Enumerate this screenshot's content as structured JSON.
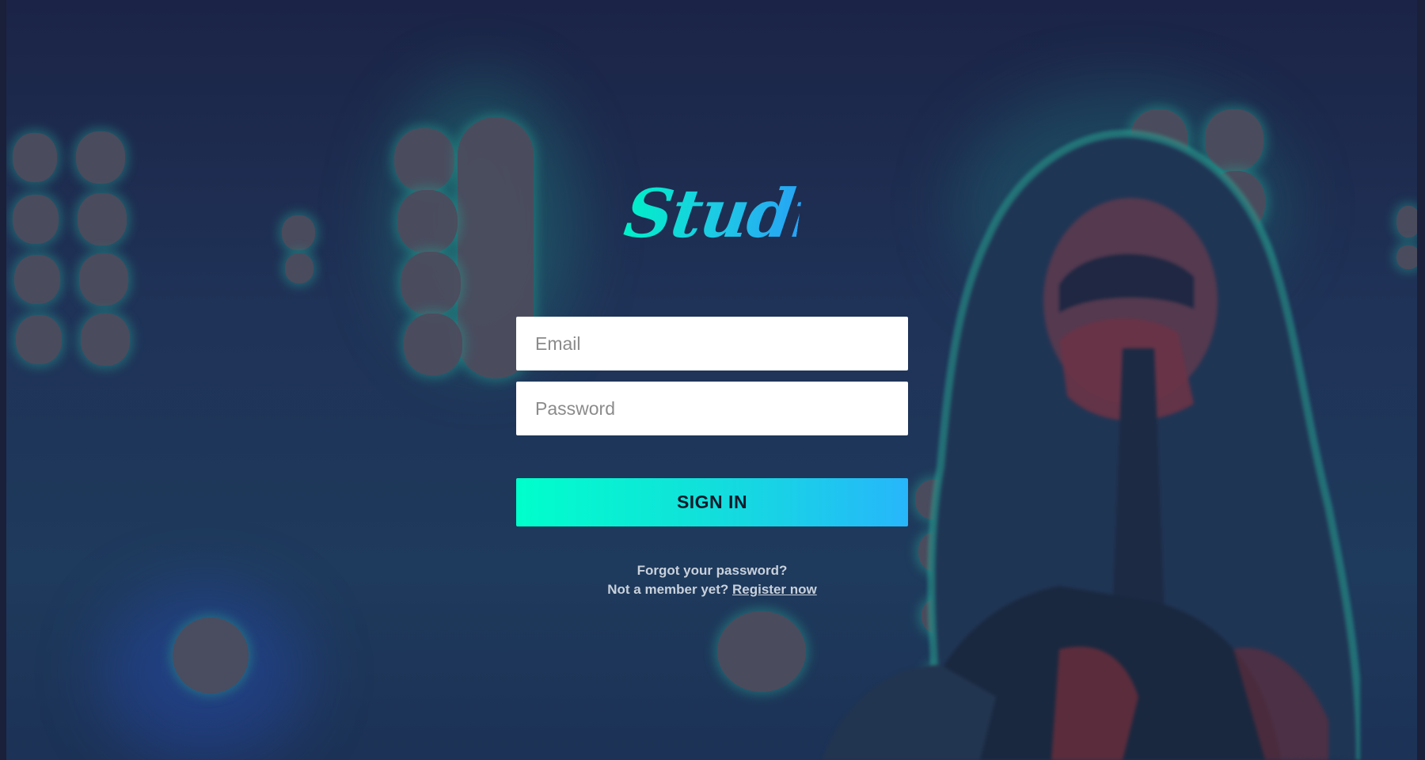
{
  "app": {
    "logo_text": "Studio"
  },
  "form": {
    "email_placeholder": "Email",
    "email_value": "",
    "password_placeholder": "Password",
    "password_value": "",
    "signin_label": "SIGN IN"
  },
  "footer_links": {
    "forgot_password": "Forgot your password?",
    "not_member": "Not a member yet?",
    "register": "Register now"
  },
  "colors": {
    "brand_gradient_start": "#00ffcb",
    "brand_gradient_end": "#27b6fb",
    "background": "#1e2b52",
    "link_text": "#c9d1dc"
  }
}
